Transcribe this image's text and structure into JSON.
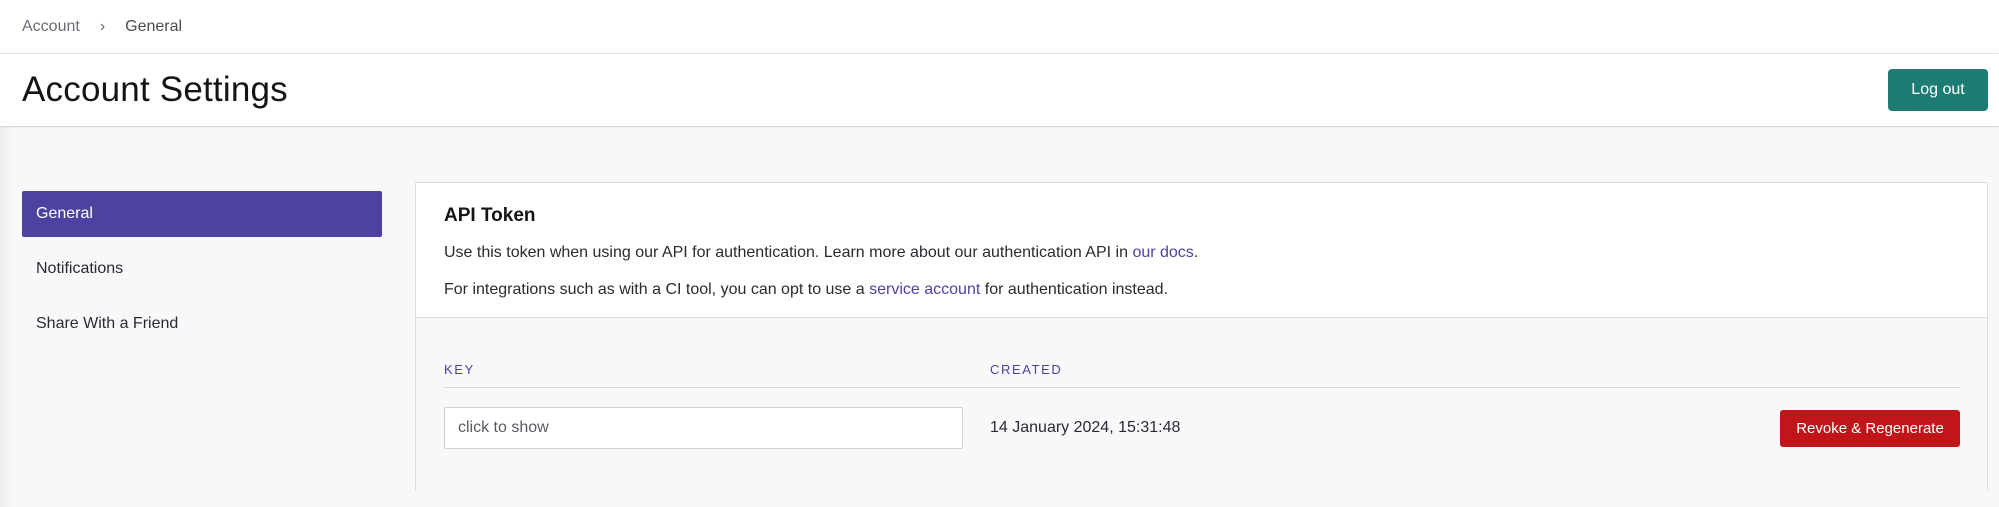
{
  "breadcrumb": {
    "items": [
      "Account",
      "General"
    ],
    "separator": "›"
  },
  "header": {
    "title": "Account Settings",
    "logout_label": "Log out"
  },
  "sidebar": {
    "items": [
      {
        "label": "General",
        "active": true
      },
      {
        "label": "Notifications",
        "active": false
      },
      {
        "label": "Share With a Friend",
        "active": false
      }
    ]
  },
  "api_token": {
    "title": "API Token",
    "line1_text": "Use this token when using our API for authentication. Learn more about our authentication API in ",
    "line1_link": "our docs",
    "line1_end": ".",
    "line2_text": "For integrations such as with a CI tool, you can opt to use a ",
    "line2_link": "service account",
    "line2_end": " for authentication instead.",
    "columns": {
      "key": "KEY",
      "created": "CREATED"
    },
    "key_placeholder": "click to show",
    "created_value": "14 January 2024, 15:31:48",
    "revoke_label": "Revoke & Regenerate"
  },
  "colors": {
    "accent": "#4e42a1",
    "logout": "#1d7d75",
    "danger": "#c0161a"
  },
  "icons": {
    "breadcrumb_separator": "chevron-right-icon"
  }
}
